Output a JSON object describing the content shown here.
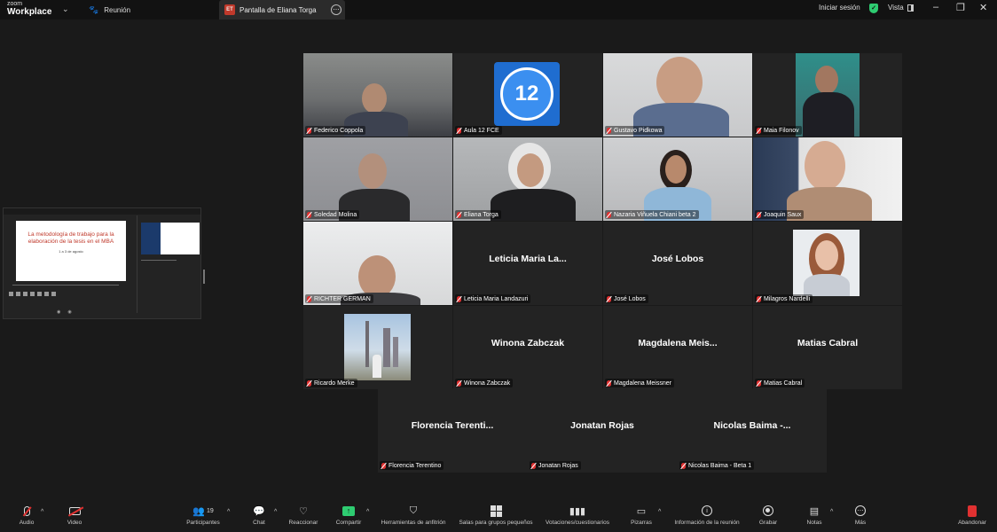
{
  "titlebar": {
    "brand_top": "zoom",
    "brand_bottom": "Workplace",
    "meeting_tab": "Reunión",
    "share_badge": "ET",
    "share_tab": "Pantalla de Eliana Torga",
    "signin": "Iniciar sesión",
    "view": "Vista"
  },
  "mini_share": {
    "slide_title": "La metodología de trabajo para la elaboración de la tesis en el MBA",
    "slide_sub": "1 a 3 de agosto"
  },
  "participants": [
    {
      "name": "Federico Coppola"
    },
    {
      "name": "Aula 12 FCE",
      "avatar_text": "12"
    },
    {
      "name": "Gustavo Pidkowa"
    },
    {
      "name": "Maia Filonov"
    },
    {
      "name": "Soledad Molina"
    },
    {
      "name": "Eliana Torga",
      "speaking": true
    },
    {
      "name": "Nazaria Viñuela Chiani beta 2"
    },
    {
      "name": "Joaquin Saux"
    },
    {
      "name": "RICHTER GERMAN"
    },
    {
      "name": "Leticia Maria Landazuri",
      "display": "Leticia Maria La..."
    },
    {
      "name": "José Lobos",
      "display": "José Lobos"
    },
    {
      "name": "Milagros Nardelli"
    },
    {
      "name": "Ricardo Merke"
    },
    {
      "name": "Winona Zabczak",
      "display": "Winona Zabczak"
    },
    {
      "name": "Magdalena Meissner",
      "display": "Magdalena Meis..."
    },
    {
      "name": "Matias Cabral",
      "display": "Matias Cabral"
    },
    {
      "name": "Florencia Terentino",
      "display": "Florencia Terenti..."
    },
    {
      "name": "Jonatan Rojas",
      "display": "Jonatan Rojas"
    },
    {
      "name": "Nicolas Baima - Beta 1",
      "display": "Nicolas Baima -..."
    }
  ],
  "toolbar": {
    "audio": "Audio",
    "video": "Video",
    "participants": "Participantes",
    "participants_count": "19",
    "chat": "Chat",
    "react": "Reaccionar",
    "share": "Compartir",
    "host_tools": "Herramientas de anfitrión",
    "breakout": "Salas para grupos pequeños",
    "polls": "Votaciones/cuestionarios",
    "whiteboards": "Pizarras",
    "info": "Información de la reunión",
    "record": "Grabar",
    "notes": "Notas",
    "more": "Más",
    "leave": "Abandonar"
  },
  "colors": {
    "accent_green": "#2ecc71",
    "mute_red": "#e03131",
    "tile_bg": "#232323",
    "app_bg": "#1a1a1a"
  }
}
